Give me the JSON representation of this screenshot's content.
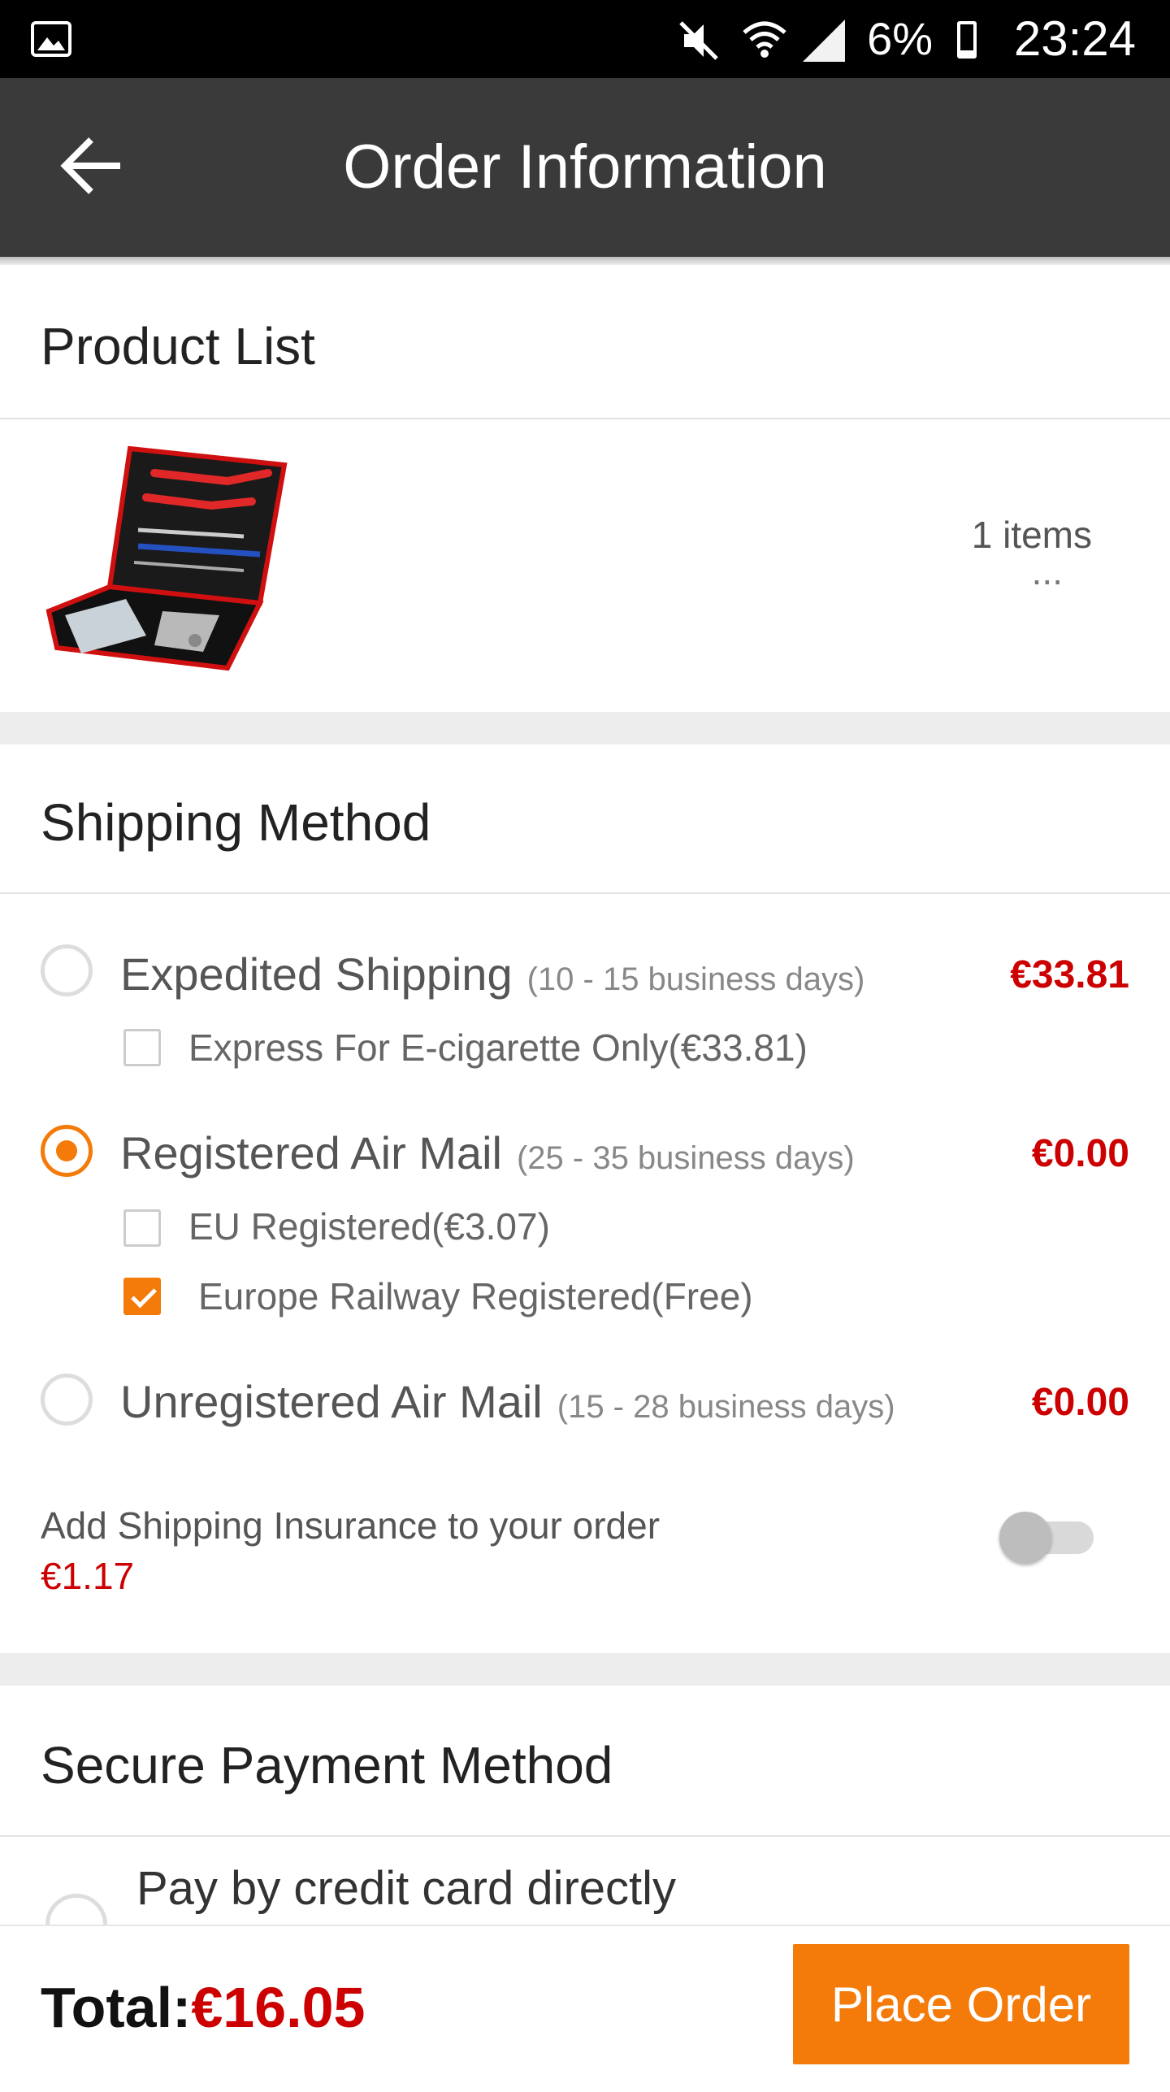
{
  "status_bar": {
    "battery": "6%",
    "time": "23:24",
    "icons": [
      "gallery-icon",
      "mute-icon",
      "wifi-icon",
      "signal-icon",
      "battery-icon"
    ]
  },
  "app_bar": {
    "title": "Order Information",
    "back_icon": "arrow-left-icon"
  },
  "product_list": {
    "title": "Product List",
    "items_count": "1 items",
    "more": "..."
  },
  "shipping": {
    "title": "Shipping Method",
    "options": [
      {
        "name": "Expedited Shipping",
        "days": "(10 - 15 business days)",
        "price": "€33.81",
        "selected": false
      },
      {
        "name": "Registered Air Mail",
        "days": "(25 - 35 business days)",
        "price": "€0.00",
        "selected": true
      },
      {
        "name": "Unregistered Air Mail",
        "days": "(15 - 28 business days)",
        "price": "€0.00",
        "selected": false
      }
    ],
    "sub_options": [
      {
        "label": "Express For E-cigarette Only(€33.81)",
        "checked": false
      },
      {
        "label": "EU Registered(€3.07)",
        "checked": false
      },
      {
        "label": "Europe Railway Registered(Free)",
        "checked": true
      }
    ],
    "insurance_label": "Add Shipping Insurance to your order",
    "insurance_price": "€1.17",
    "insurance_enabled": false
  },
  "payment": {
    "title": "Secure Payment Method",
    "option": "Pay by credit card directly"
  },
  "bottom_bar": {
    "total_label": "Total:",
    "total_amount": "€16.05",
    "place_order_label": "Place Order"
  },
  "colors": {
    "accent": "#f47b0a",
    "price": "#cc0000",
    "app_bar": "#3a3a3a"
  }
}
